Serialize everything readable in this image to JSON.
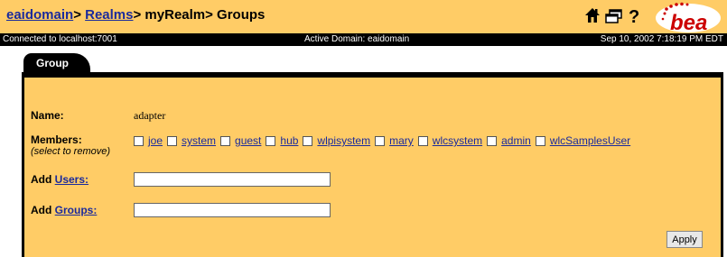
{
  "header": {
    "breadcrumb": [
      {
        "label": "eaidomain",
        "link": true
      },
      {
        "label": "> ",
        "link": false
      },
      {
        "label": "Realms",
        "link": true
      },
      {
        "label": "> myRealm> Groups",
        "link": false
      }
    ],
    "icons": [
      "home-icon",
      "window-icon",
      "help-icon"
    ],
    "logo_text": "bea"
  },
  "status_bar": {
    "connection": "Connected to localhost:7001",
    "active_domain": "Active Domain: eaidomain",
    "timestamp": "Sep 10, 2002 7:18:19 PM EDT"
  },
  "tab": {
    "label": "Group"
  },
  "form": {
    "name_label": "Name:",
    "name_value": "adapter",
    "members_label": "Members:",
    "members_hint": "(select to remove)",
    "members": [
      "joe",
      "system",
      "guest",
      "hub",
      "wlpisystem",
      "mary",
      "wlcsystem",
      "admin",
      "wlcSamplesUser"
    ],
    "add_users_prefix": "Add",
    "add_users_link": "Users:",
    "add_users_value": "",
    "add_groups_prefix": "Add",
    "add_groups_link": "Groups:",
    "add_groups_value": "",
    "apply_label": "Apply"
  },
  "colors": {
    "background": "#ffcc66",
    "bar": "#000000",
    "link": "#1a2a9c",
    "logo": "#cc0000"
  }
}
